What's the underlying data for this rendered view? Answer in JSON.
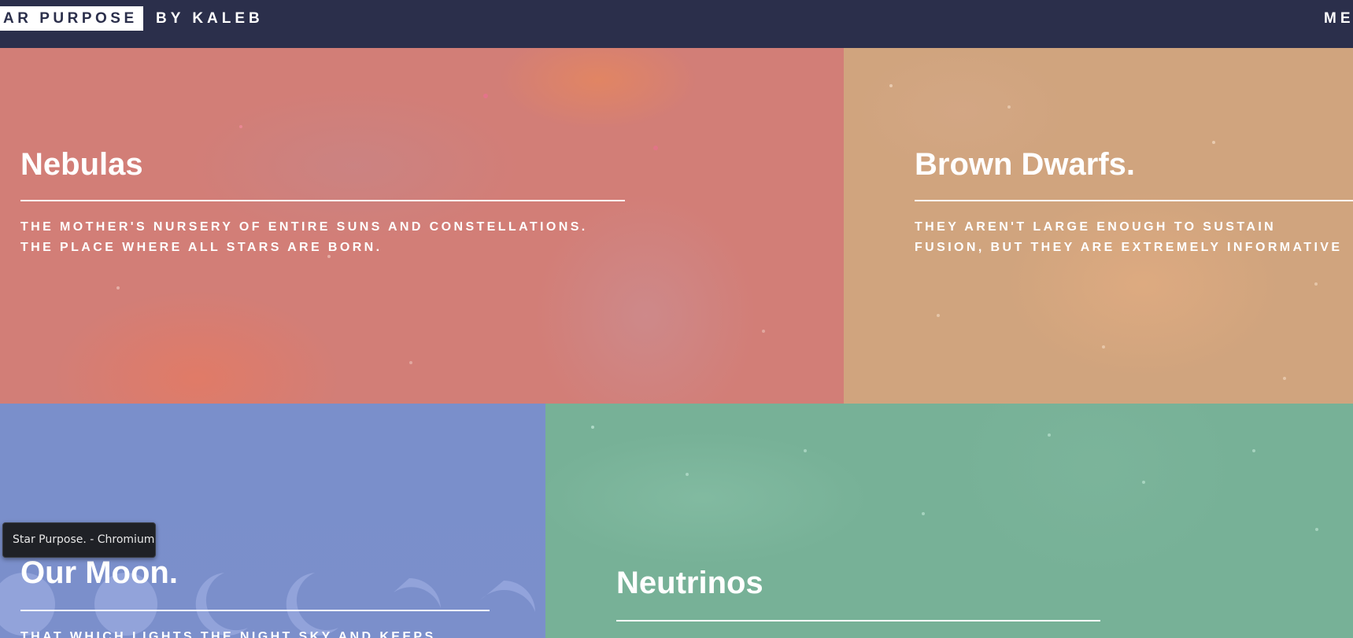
{
  "header": {
    "brand_boxed": "AR PURPOSE",
    "brand_by": "BY KALEB",
    "menu_label": "ME"
  },
  "cards": [
    {
      "title": "Nebulas",
      "line1": "THE MOTHER'S NURSERY OF ENTIRE SUNS AND CONSTELLATIONS.",
      "line2": "THE PLACE WHERE ALL STARS ARE BORN.",
      "color": "#d27e77"
    },
    {
      "title": "Brown Dwarfs.",
      "line1": "THEY AREN'T LARGE ENOUGH TO SUSTAIN",
      "line2": "FUSION, BUT THEY ARE EXTREMELY INFORMATIVE",
      "color": "#d0a47e"
    },
    {
      "title": "Our Moon.",
      "line1": "THAT WHICH LIGHTS THE NIGHT SKY AND KEEPS",
      "color": "#7a8fcb"
    },
    {
      "title": "Neutrinos",
      "color": "#77b197"
    }
  ],
  "tooltip": "Star Purpose. - Chromium",
  "header_color": "#2b2f4b"
}
